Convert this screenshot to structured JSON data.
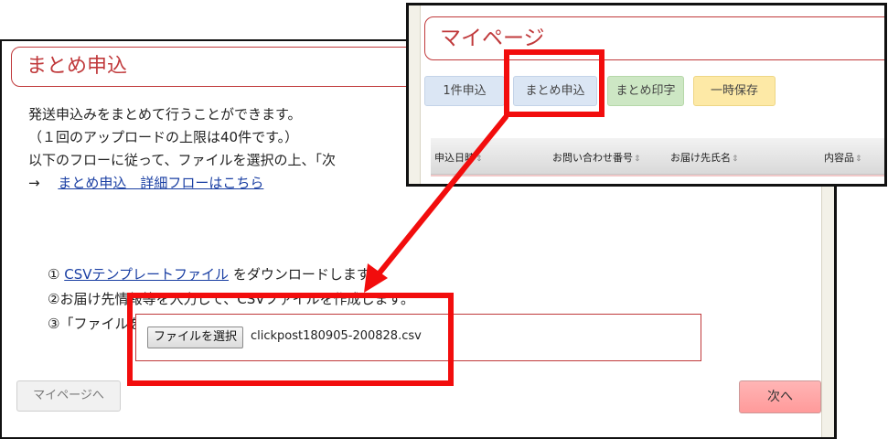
{
  "main": {
    "title": "まとめ申込",
    "description": [
      "発送申込みをまとめて行うことができます。",
      "（１回のアップロードの上限は40件です。）",
      "以下のフローに従って、ファイルを選択の上、「次"
    ],
    "flow_link_prefix": "→　",
    "flow_link_label": "まとめ申込　詳細フローはこちら",
    "steps": {
      "step1_prefix": "①",
      "step1_link": "CSVテンプレートファイル",
      "step1_suffix": "をダウンロードします。",
      "step2": "②お届け先情報等を入力して、CSVファイルを作成します。",
      "step3": "③「ファイルを選択」をクリックし、アップロードするCSVファイルを選択します。"
    },
    "file_button_label": "ファイルを選択",
    "file_name": "clickpost180905-200828.csv",
    "mypage_button_label": "マイページへ",
    "next_button_label": "次へ"
  },
  "overlay": {
    "title": "マイページ",
    "tabs": [
      "1件申込",
      "まとめ申込",
      "まとめ印字",
      "一時保存"
    ],
    "table_headers": [
      "申込日時",
      "お問い合わせ番号",
      "お届け先氏名",
      "内容品"
    ],
    "sort_icon": "⇕"
  },
  "colors": {
    "accent_red": "#c0393b",
    "annotation_red": "#f20d0d",
    "next_button": "#ff9a9a"
  }
}
